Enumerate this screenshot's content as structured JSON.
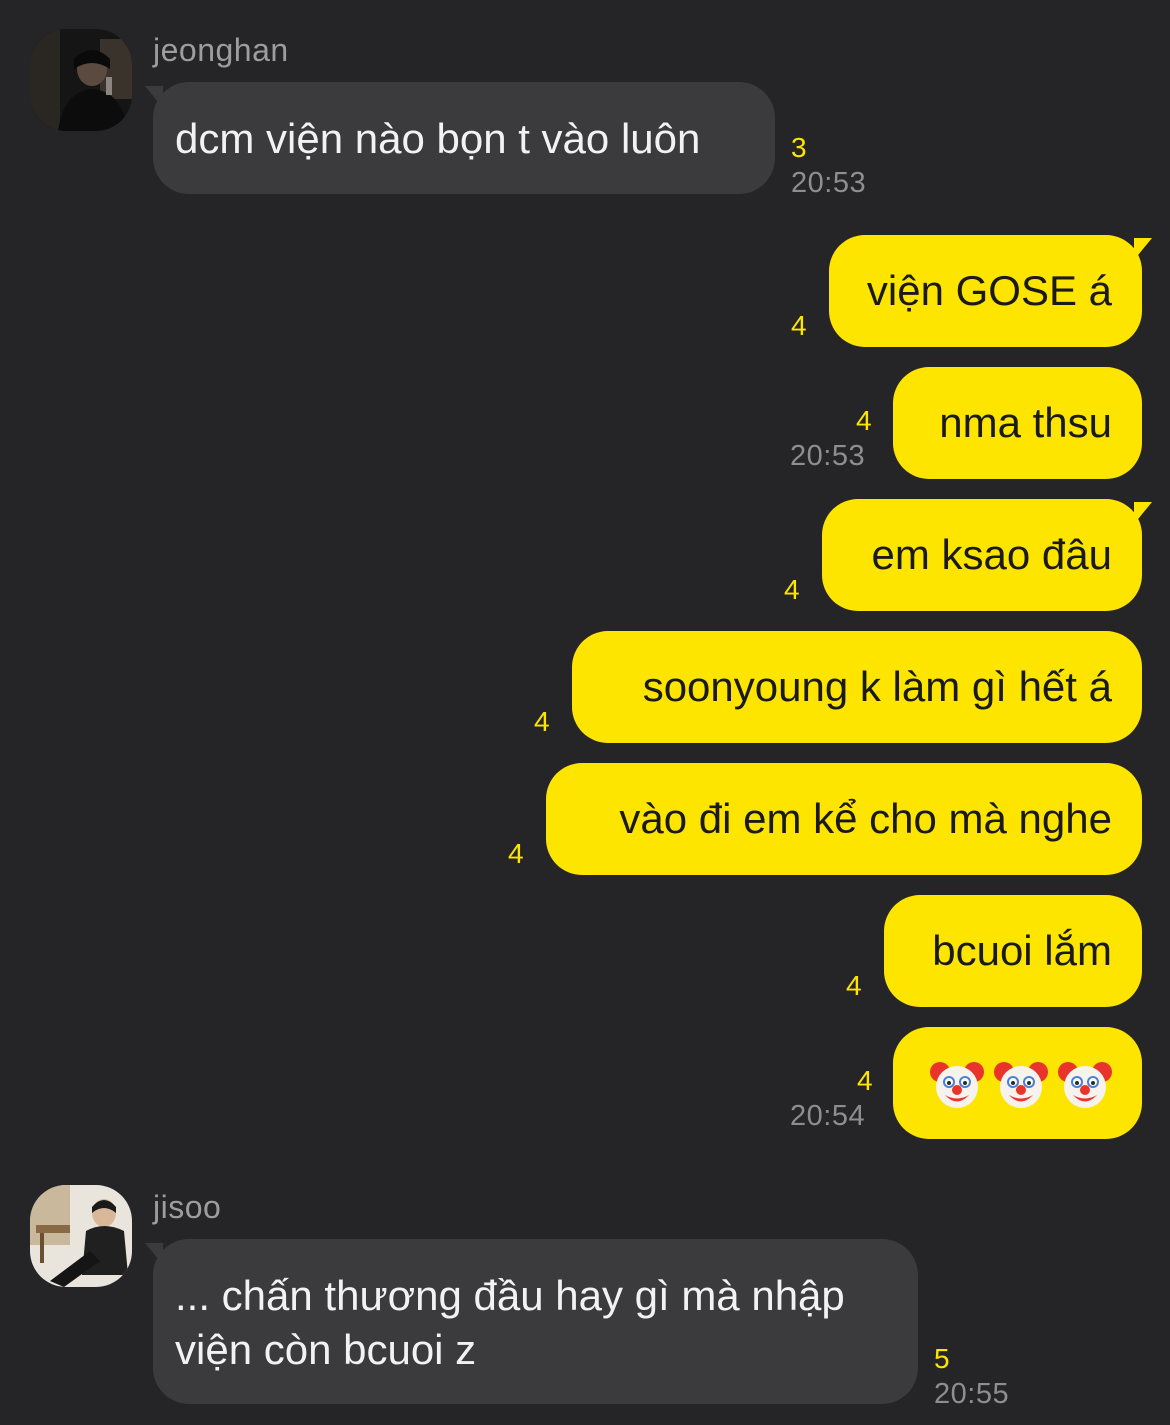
{
  "messages": [
    {
      "sender": "jeonghan",
      "text": "dcm viện nào bọn t vào luôn",
      "unread": "3",
      "time": "20:53"
    },
    {
      "text": "viện GOSE á",
      "unread": "4"
    },
    {
      "text": "nma thsu",
      "unread": "4",
      "time": "20:53"
    },
    {
      "text": "em ksao đâu",
      "unread": "4"
    },
    {
      "text": "soonyoung k làm gì hết á",
      "unread": "4"
    },
    {
      "text": "vào đi em kể cho mà nghe",
      "unread": "4"
    },
    {
      "text": "bcuoi lắm",
      "unread": "4"
    },
    {
      "emoji": [
        "clown-face",
        "clown-face",
        "clown-face"
      ],
      "unread": "4",
      "time": "20:54"
    },
    {
      "sender": "jisoo",
      "text": "... chấn thương đầu hay gì mà nhập viện còn bcuoi z",
      "unread": "5",
      "time": "20:55"
    }
  ],
  "colors": {
    "background": "#252527",
    "incoming_bubble": "#3b3b3d",
    "outgoing_bubble": "#fee500",
    "unread_count": "#fee500",
    "timestamp": "#8e8e90"
  }
}
